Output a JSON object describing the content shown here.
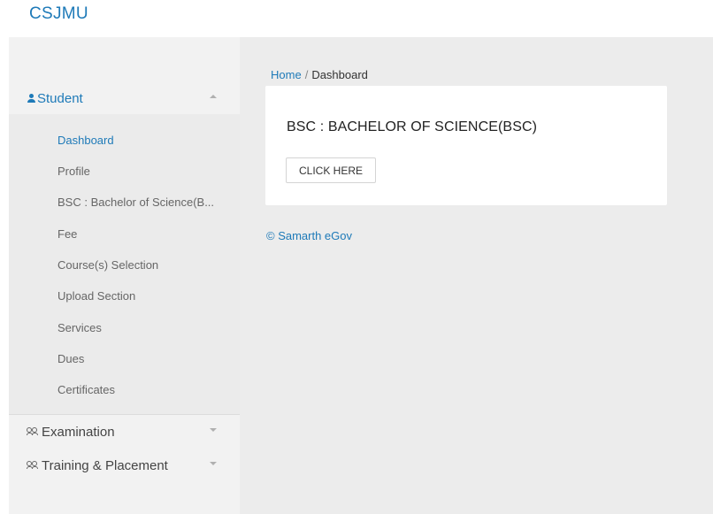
{
  "header": {
    "brand": "CSJMU"
  },
  "sidebar": {
    "student": {
      "label": "Student",
      "items": [
        {
          "label": "Dashboard",
          "active": true
        },
        {
          "label": "Profile"
        },
        {
          "label": "BSC : Bachelor of Science(B..."
        },
        {
          "label": "Fee"
        },
        {
          "label": "Course(s) Selection"
        },
        {
          "label": "Upload Section"
        },
        {
          "label": "Services"
        },
        {
          "label": "Dues"
        },
        {
          "label": "Certificates"
        }
      ]
    },
    "examination": {
      "label": "Examination"
    },
    "training": {
      "label": "Training & Placement"
    }
  },
  "breadcrumb": {
    "home": "Home",
    "separator": "/",
    "current": "Dashboard"
  },
  "card": {
    "title": "BSC : BACHELOR OF SCIENCE(BSC)",
    "button_label": "CLICK HERE"
  },
  "footer": {
    "text": "© Samarth eGov"
  },
  "colors": {
    "accent": "#1e7ab8",
    "sidebar_bg": "#f2f2f2",
    "submenu_bg": "#ebebeb",
    "content_bg": "#ececec"
  },
  "icons": {
    "student": "person-icon",
    "examination": "group-icon",
    "training": "group-icon",
    "expanded": "caret-up-icon",
    "collapsed": "caret-down-icon"
  }
}
